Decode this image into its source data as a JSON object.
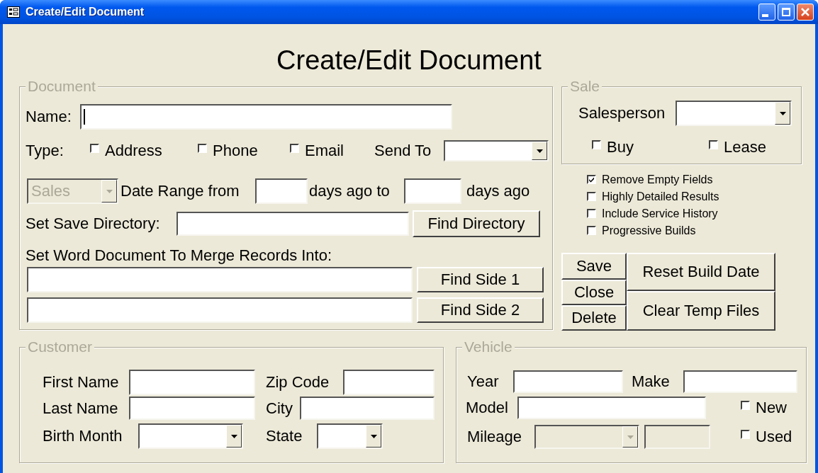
{
  "window": {
    "title": "Create/Edit Document"
  },
  "heading": "Create/Edit Document",
  "document": {
    "legend": "Document",
    "name": {
      "label": "Name:",
      "focused": true
    },
    "type": {
      "label": "Type:",
      "options": [
        {
          "label": "Address",
          "checked": false
        },
        {
          "label": "Phone",
          "checked": false
        },
        {
          "label": "Email",
          "checked": false
        }
      ]
    },
    "send_to": {
      "label": "Send To"
    },
    "category": {
      "value": "Sales",
      "disabled": true
    },
    "date_range": {
      "from_label": "Date Range from",
      "to_label": "days ago to",
      "end_label": "days ago"
    },
    "save_directory": {
      "label": "Set Save Directory:",
      "button": "Find Directory"
    },
    "merge": {
      "label": "Set Word Document To Merge Records Into:",
      "buttons": [
        "Find Side 1",
        "Find Side 2"
      ]
    }
  },
  "sale": {
    "legend": "Sale",
    "salesperson_label": "Salesperson",
    "options": [
      {
        "label": "Buy",
        "checked": false
      },
      {
        "label": "Lease",
        "checked": false
      }
    ]
  },
  "options": [
    {
      "label": "Remove Empty Fields",
      "checked": true
    },
    {
      "label": "Highly Detailed Results",
      "checked": false
    },
    {
      "label": "Include Service History",
      "checked": false
    },
    {
      "label": "Progressive Builds",
      "checked": false
    }
  ],
  "actions": {
    "left": [
      "Save",
      "Close",
      "Delete"
    ],
    "right": [
      "Reset Build Date",
      "Clear Temp Files"
    ]
  },
  "customer": {
    "legend": "Customer",
    "first_name_label": "First Name",
    "last_name_label": "Last Name",
    "birth_month_label": "Birth Month",
    "zip_code_label": "Zip Code",
    "city_label": "City",
    "state_label": "State"
  },
  "vehicle": {
    "legend": "Vehicle",
    "year_label": "Year",
    "make_label": "Make",
    "model_label": "Model",
    "mileage": {
      "label": "Mileage",
      "disabled": true
    },
    "condition": [
      {
        "label": "New",
        "checked": false
      },
      {
        "label": "Used",
        "checked": false
      }
    ]
  }
}
